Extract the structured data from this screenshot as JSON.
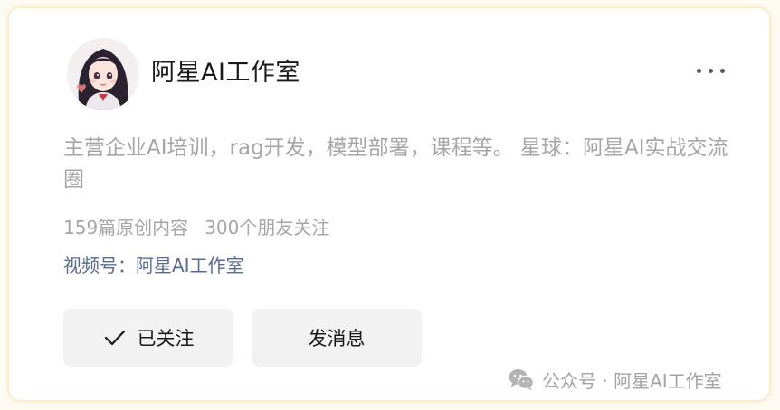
{
  "account": {
    "name": "阿星AI工作室"
  },
  "description": "主营企业AI培训，rag开发，模型部署，课程等。 星球：阿星AI实战交流圈",
  "stats": {
    "articles": "159篇原创内容",
    "followers": "300个朋友关注"
  },
  "channel": {
    "text": "视频号：阿星AI工作室"
  },
  "buttons": {
    "follow_label": "已关注",
    "message_label": "发消息"
  },
  "footer": {
    "text": "公众号 · 阿星AI工作室"
  },
  "icons": {
    "more": "more-dots-icon",
    "check": "check-icon",
    "wechat": "wechat-icon"
  },
  "colors": {
    "link": "#576b95",
    "secondary_text": "#a6a6a6",
    "button_bg": "#f2f2f2"
  }
}
